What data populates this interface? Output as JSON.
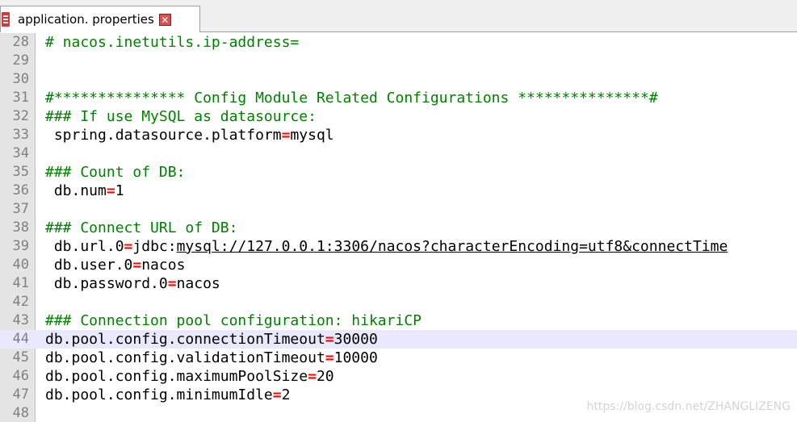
{
  "tab": {
    "label": "application. properties",
    "close_glyph": "✕"
  },
  "lines": [
    {
      "num": "28",
      "type": "comment",
      "text": "# nacos.inetutils.ip-address="
    },
    {
      "num": "29",
      "type": "blank",
      "text": ""
    },
    {
      "num": "30",
      "type": "blank",
      "text": ""
    },
    {
      "num": "31",
      "type": "comment",
      "text": "#*************** Config Module Related Configurations ***************#"
    },
    {
      "num": "32",
      "type": "comment",
      "text": "### If use MySQL as datasource:"
    },
    {
      "num": "33",
      "type": "kv",
      "key": " spring.datasource.platform",
      "value": "mysql"
    },
    {
      "num": "34",
      "type": "blank",
      "text": ""
    },
    {
      "num": "35",
      "type": "comment",
      "text": "### Count of DB:"
    },
    {
      "num": "36",
      "type": "kv",
      "key": " db.num",
      "value": "1"
    },
    {
      "num": "37",
      "type": "blank",
      "text": ""
    },
    {
      "num": "38",
      "type": "comment",
      "text": "### Connect URL of DB:"
    },
    {
      "num": "39",
      "type": "kv",
      "key": " db.url.0",
      "value_prefix": "jdbc:",
      "value_url": "mysql://127.0.0.1:3306/nacos?characterEncoding=utf8&connectTime"
    },
    {
      "num": "40",
      "type": "kv",
      "key": " db.user.0",
      "value": "nacos"
    },
    {
      "num": "41",
      "type": "kv",
      "key": " db.password.0",
      "value": "nacos"
    },
    {
      "num": "42",
      "type": "blank",
      "text": ""
    },
    {
      "num": "43",
      "type": "comment",
      "text": "### Connection pool configuration: hikariCP"
    },
    {
      "num": "44",
      "type": "kv",
      "key": "db.pool.config.connectionTimeout",
      "value": "30000",
      "highlight": true
    },
    {
      "num": "45",
      "type": "kv",
      "key": "db.pool.config.validationTimeout",
      "value": "10000"
    },
    {
      "num": "46",
      "type": "kv",
      "key": "db.pool.config.maximumPoolSize",
      "value": "20"
    },
    {
      "num": "47",
      "type": "kv",
      "key": "db.pool.config.minimumIdle",
      "value": "2"
    },
    {
      "num": "48",
      "type": "blank",
      "text": ""
    }
  ],
  "watermark": "https://blog.csdn.net/ZHANGLIZENG",
  "colors": {
    "comment": "#008000",
    "operator": "#ff0000",
    "current_line": "#e8e8ff"
  },
  "icons": {
    "file": "file-icon",
    "close": "close-icon"
  }
}
